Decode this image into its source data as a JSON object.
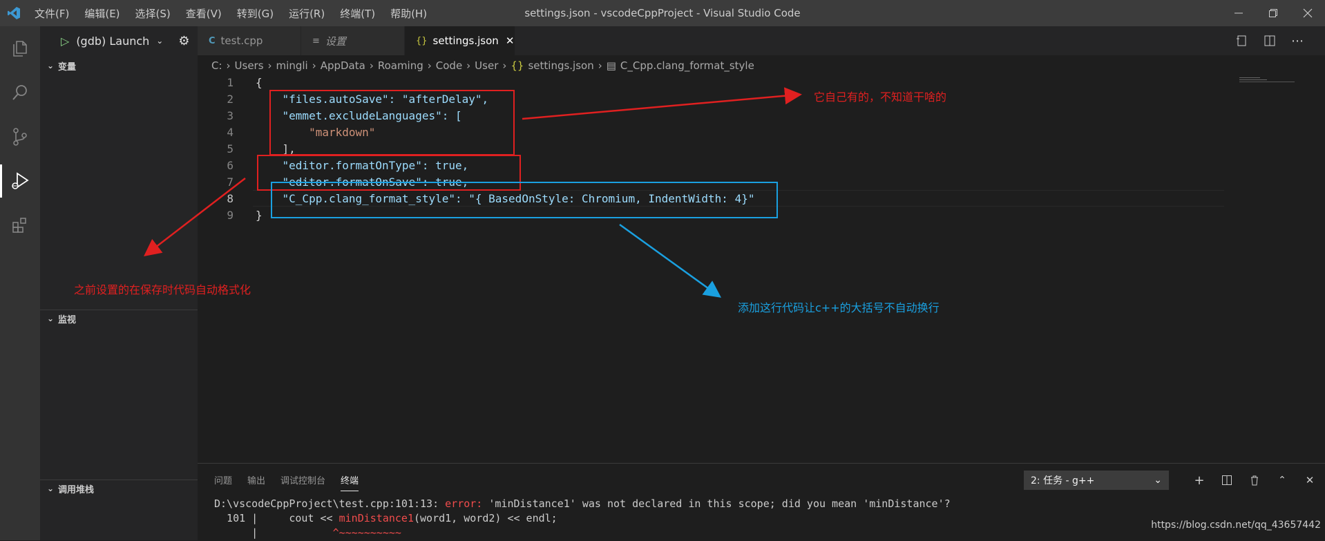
{
  "titlebar": {
    "menu": [
      "文件(F)",
      "编辑(E)",
      "选择(S)",
      "查看(V)",
      "转到(G)",
      "运行(R)",
      "终端(T)",
      "帮助(H)"
    ],
    "title": "settings.json - vscodeCppProject - Visual Studio Code"
  },
  "sidebar": {
    "run_config": "(gdb) Launch",
    "sections": [
      "变量",
      "监视",
      "调用堆栈"
    ]
  },
  "tabs": [
    {
      "label": "test.cpp",
      "icon": "C"
    },
    {
      "label": "设置",
      "icon": "≡"
    },
    {
      "label": "settings.json",
      "icon": "{}"
    }
  ],
  "breadcrumb": [
    "C:",
    "Users",
    "mingli",
    "AppData",
    "Roaming",
    "Code",
    "User",
    "settings.json",
    "C_Cpp.clang_format_style"
  ],
  "editor": {
    "line_numbers": [
      "1",
      "2",
      "3",
      "4",
      "5",
      "6",
      "7",
      "8",
      "9"
    ],
    "current_line": 8,
    "lines": [
      "{",
      "    \"files.autoSave\": \"afterDelay\",",
      "    \"emmet.excludeLanguages\": [",
      "        \"markdown\"",
      "    ],",
      "    \"editor.formatOnType\": true,",
      "    \"editor.formatOnSave\": true,",
      "    \"C_Cpp.clang_format_style\": \"{ BasedOnStyle: Chromium, IndentWidth: 4}\"",
      "}"
    ]
  },
  "annotations": {
    "note_top_right": "它自己有的，不知道干啥的",
    "note_left": "之前设置的在保存时代码自动格式化",
    "note_blue": "添加这行代码让c++的大括号不自动换行"
  },
  "panel": {
    "tabs": [
      "问题",
      "输出",
      "调试控制台",
      "终端"
    ],
    "active_tab": "终端",
    "terminal_select": "2: 任务 - g++",
    "terminal_lines": {
      "line1_path": "D:\\vscodeCppProject\\test.cpp:101:13: ",
      "line1_error": "error:",
      "line1_msg": " 'minDistance1' was not declared in this scope; did you mean 'minDistance'?",
      "line2_num": "  101 |     cout << ",
      "line2_err": "minDistance1",
      "line2_rest": "(word1, word2) << endl;",
      "line3_bar": "      |",
      "line3_tilde": "            ^~~~~~~~~~~"
    }
  },
  "watermark": "https://blog.csdn.net/qq_43657442",
  "colors": {
    "annotation_red": "#e02020",
    "annotation_blue": "#1aa0e0",
    "activity_bar": "#333333",
    "sidebar": "#252526",
    "editor": "#1e1e1e"
  }
}
